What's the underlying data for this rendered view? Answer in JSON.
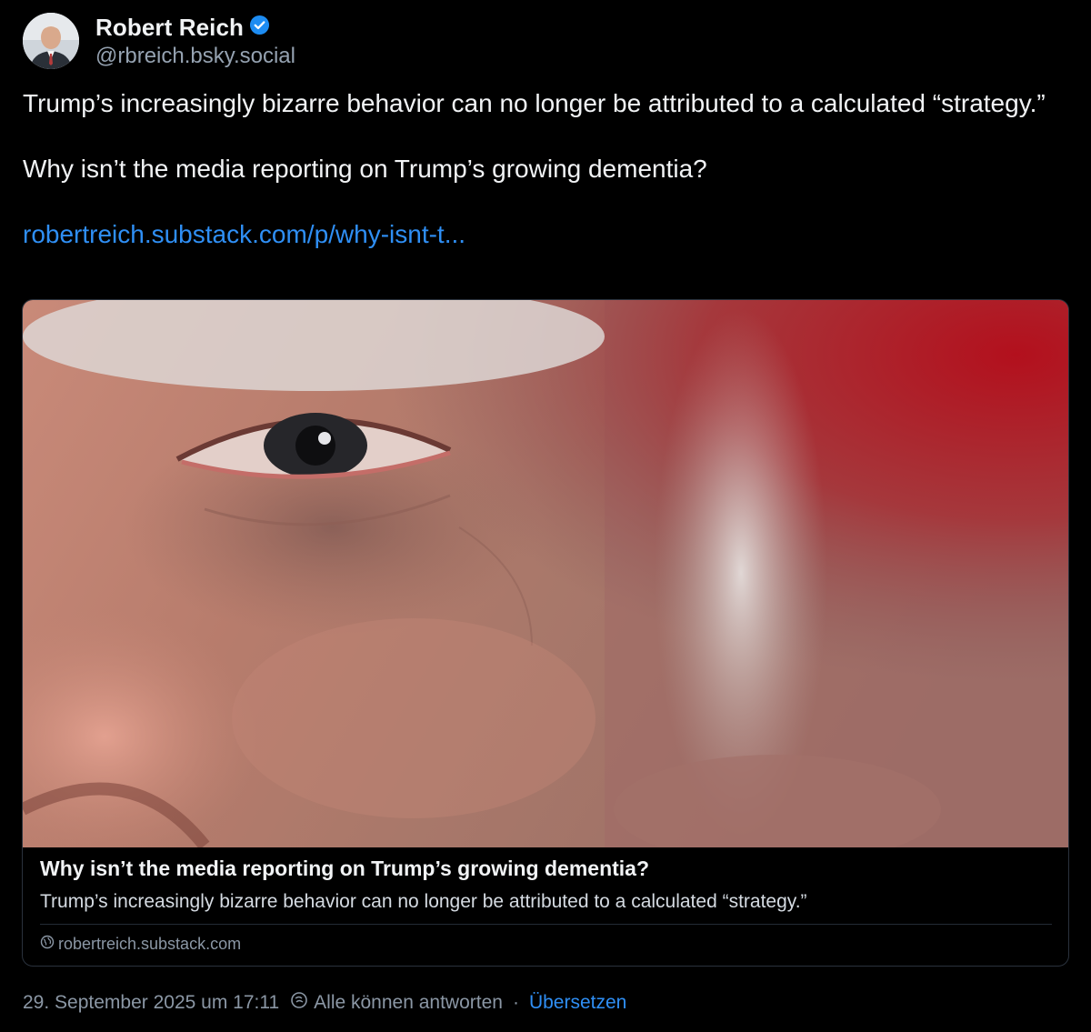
{
  "author": {
    "display_name": "Robert Reich",
    "handle": "@rbreich.bsky.social",
    "avatar_icon": "avatar-photo",
    "verified_icon": "verified-check-icon",
    "verified_color": "#1d8cf2"
  },
  "post": {
    "paragraph_1": "Trump’s increasingly bizarre behavior can no longer be attributed to a calculated “strategy.”",
    "paragraph_2": "Why isn’t the media reporting on Trump’s growing dementia?",
    "link_text": "robertreich.substack.com/p/why-isnt-t..."
  },
  "card": {
    "title": "Why isn’t the media reporting on Trump’s growing dementia?",
    "description": "Trump’s increasingly bizarre behavior can no longer be attributed to a calculated “strategy.”",
    "domain": "robertreich.substack.com",
    "domain_icon": "globe-icon"
  },
  "footer": {
    "timestamp": "29. September 2025 um 17:11",
    "reply_setting": "Alle können antworten",
    "separator": "·",
    "translate_label": "Übersetzen",
    "reply_icon": "reply-restriction-icon"
  },
  "colors": {
    "background": "#000000",
    "link": "#2f8ff5",
    "muted": "#8b97a5",
    "text": "#f1f3f5"
  }
}
